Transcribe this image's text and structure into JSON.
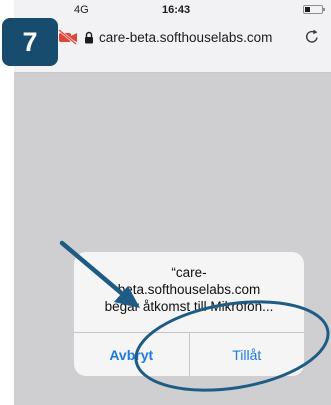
{
  "badge": {
    "step": "7"
  },
  "status_bar": {
    "network": "4G",
    "time": "16:43"
  },
  "browser": {
    "url": "care-beta.softhouselabs.com"
  },
  "dialog": {
    "line1": "“care-",
    "line2": "beta.softhouselabs.com",
    "line3": "begär åtkomst till Mikrofon...",
    "cancel": "Avbryt",
    "allow": "Tillåt"
  },
  "icons": {
    "camera": "camera-off-icon",
    "lock": "lock-icon",
    "reload": "reload-icon"
  },
  "colors": {
    "badge": "#184c6e",
    "annotation": "#1e5c86",
    "button_text": "#1f7ae0",
    "camera_icon": "#e0453a"
  }
}
